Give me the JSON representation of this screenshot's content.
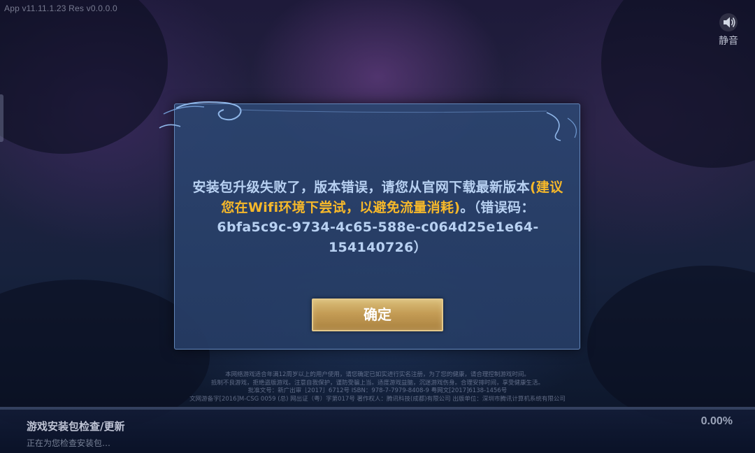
{
  "app": {
    "version_text": "App v11.11.1.23   Res v0.0.0.0"
  },
  "mute": {
    "label": "静音",
    "icon": "speaker-icon"
  },
  "dialog": {
    "message_part1": "安装包升级失败了，版本错误，请您从官网下载最新版本",
    "message_highlight": "(建议您在Wifi环境下尝试，以避免流量消耗)",
    "message_part2": "。（错误码：6bfa5c9c-9734-4c65-588e-c064d25e1e64-154140726）",
    "confirm_label": "确定",
    "highlight_color": "#f6b82a",
    "text_color": "#b8d1f2"
  },
  "notice": {
    "line1": "本网络游戏适合年满12周岁以上的用户使用，请您确定已如实进行实名注册，为了您的健康，请合理控制游戏时间。",
    "line2": "抵制不良游戏，拒绝盗版游戏。注意自我保护，谨防受骗上当。适度游戏益脑，沉迷游戏伤身。合理安排时间，享受健康生活。",
    "line3": "批准文号：新广出审［2017］6712号  ISBN：978-7-7979-8408-9  粤网文[2017]6138-1456号",
    "line4": "文网游备字[2016]M-CSG 0059  (总) 网出证（粤）字第017号  著作权人：腾讯科技(成都)有限公司  出版单位：深圳市腾讯计算机系统有限公司"
  },
  "progress": {
    "title": "游戏安装包检查/更新",
    "subtitle": "正在为您检查安装包…",
    "percent_text": "0.00%",
    "value": 0.0
  }
}
